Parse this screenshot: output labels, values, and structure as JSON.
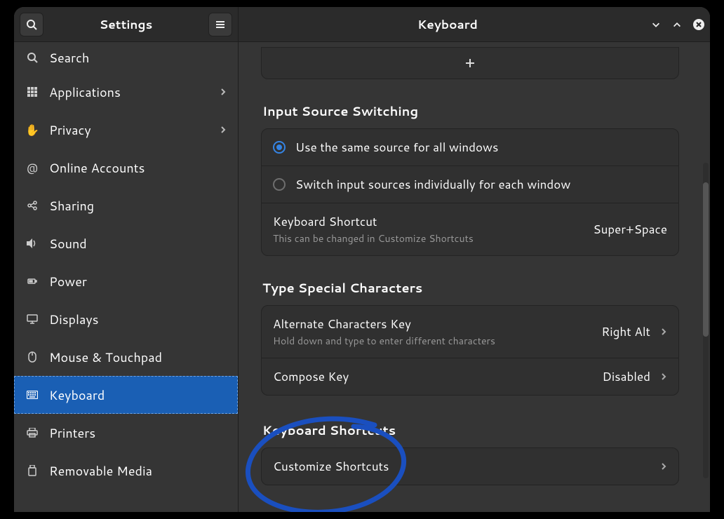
{
  "header": {
    "left_title": "Settings",
    "right_title": "Keyboard"
  },
  "sidebar": {
    "items": [
      {
        "icon": "search-icon",
        "label": "Search",
        "chevron": false
      },
      {
        "icon": "grid-icon",
        "label": "Applications",
        "chevron": true
      },
      {
        "icon": "hand-icon",
        "label": "Privacy",
        "chevron": true
      },
      {
        "icon": "at-icon",
        "label": "Online Accounts",
        "chevron": false
      },
      {
        "icon": "share-icon",
        "label": "Sharing",
        "chevron": false
      },
      {
        "icon": "sound-icon",
        "label": "Sound",
        "chevron": false
      },
      {
        "icon": "power-icon",
        "label": "Power",
        "chevron": false
      },
      {
        "icon": "display-icon",
        "label": "Displays",
        "chevron": false
      },
      {
        "icon": "mouse-icon",
        "label": "Mouse & Touchpad",
        "chevron": false
      },
      {
        "icon": "keyboard-icon",
        "label": "Keyboard",
        "chevron": false,
        "selected": true
      },
      {
        "icon": "printer-icon",
        "label": "Printers",
        "chevron": false
      },
      {
        "icon": "usb-icon",
        "label": "Removable Media",
        "chevron": false
      }
    ]
  },
  "main": {
    "add_icon": "plus-icon",
    "section_input_switching": {
      "title": "Input Source Switching",
      "radio_same": "Use the same source for all windows",
      "radio_individual": "Switch input sources individually for each window",
      "shortcut_label": "Keyboard Shortcut",
      "shortcut_sub": "This can be changed in Customize Shortcuts",
      "shortcut_value": "Super+Space"
    },
    "section_special_chars": {
      "title": "Type Special Characters",
      "alt_label": "Alternate Characters Key",
      "alt_sub": "Hold down and type to enter different characters",
      "alt_value": "Right Alt",
      "compose_label": "Compose Key",
      "compose_value": "Disabled"
    },
    "section_shortcuts": {
      "title": "Keyboard Shortcuts",
      "customize_label": "Customize Shortcuts"
    }
  }
}
